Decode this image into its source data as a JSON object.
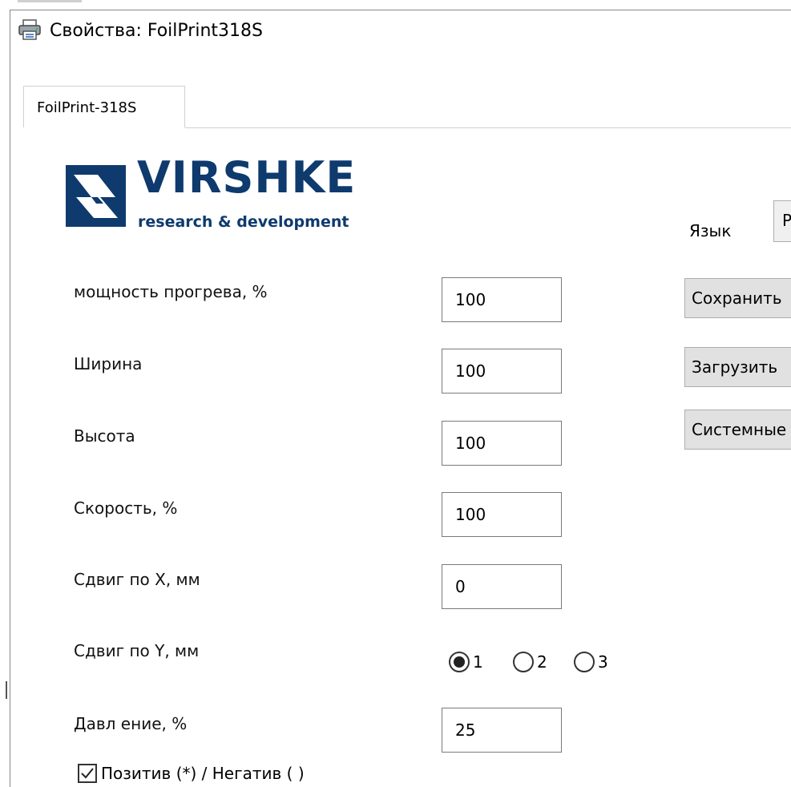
{
  "window": {
    "title": "Свойства: FoilPrint318S",
    "icon": "printer-icon"
  },
  "tab": {
    "label": "FoilPrint-318S"
  },
  "logo": {
    "word": "VIRSHKE",
    "tagline": "research & development",
    "brand_color": "#0e3a6e"
  },
  "language": {
    "label": "Язык",
    "selected": "Р"
  },
  "buttons": {
    "save": "Сохранить",
    "load": "Загрузить",
    "system": "Системные"
  },
  "fields": [
    {
      "label": "мощность прогрева, %",
      "value": "100"
    },
    {
      "label": "Ширина",
      "value": "100"
    },
    {
      "label": "Высота",
      "value": "100"
    },
    {
      "label": "Скорость, %",
      "value": "100"
    },
    {
      "label": "Сдвиг по X, мм",
      "value": "0"
    }
  ],
  "shift_y": {
    "label": "Сдвиг по Y, мм",
    "options": [
      {
        "label": "1",
        "selected": true
      },
      {
        "label": "2",
        "selected": false
      },
      {
        "label": "3",
        "selected": false
      }
    ]
  },
  "pressure": {
    "label": "Давл ение, %",
    "value": "25"
  },
  "positive": {
    "label": "Позитив (*) / Негатив ( )",
    "checked": true
  }
}
